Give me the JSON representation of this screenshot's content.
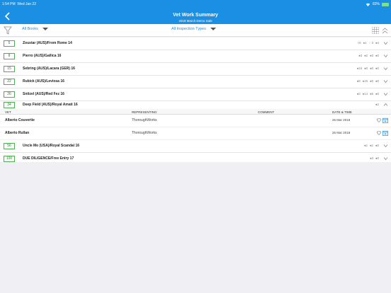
{
  "status_bar": {
    "time": "1:54 PM",
    "date": "Wed Jan 22",
    "battery_pct": "83%"
  },
  "header": {
    "title": "Vet Work Summary",
    "subtitle": "2018 March Demo Sale"
  },
  "filters": {
    "books": "All Books",
    "inspection_types": "All Inspection Types"
  },
  "vet_table": {
    "headers": {
      "vet": "VET",
      "representing": "REPRESENTING",
      "comment": "COMMENT",
      "datetime": "DATE & TIME"
    }
  },
  "lots": [
    {
      "lot": "5",
      "horse": "Zoustar (AUS)/From Rome 14",
      "counts": [
        "☇8",
        "♠1",
        "♢3",
        "♠4"
      ],
      "expanded": false
    },
    {
      "lot": "8",
      "horse": "Pierro (AUS)/Gallica 16",
      "counts": [
        "♠3",
        "♠2",
        "♠3",
        "♠0"
      ],
      "expanded": false
    },
    {
      "lot": "15",
      "horse": "Sebring (AUS)/Lacara (GER) 16",
      "counts": [
        "♠16",
        "♠0",
        "♠0",
        "♠0"
      ],
      "expanded": false
    },
    {
      "lot": "22",
      "horse": "Rubick (AUS)/Leviosa 16",
      "counts": [
        "♠9",
        "♠16",
        "♠0",
        "♠0"
      ],
      "expanded": false
    },
    {
      "lot": "26",
      "horse": "Snitzel (AUS)/Red Fez 16",
      "counts": [
        "♠3",
        "♠14",
        "♠5",
        "♠0"
      ],
      "expanded": false
    },
    {
      "lot": "34",
      "horse": "Deep Field (AUS)/Royal Amati 16",
      "counts": [
        "♠2"
      ],
      "expanded": true,
      "vets": [
        {
          "name": "Alberto Couvertie",
          "representing": "ThoroughWorks",
          "comment": "",
          "date": "26 Mar 2018"
        },
        {
          "name": "Alberto Rullan",
          "representing": "ThoroughWorks",
          "comment": "",
          "date": "26 Mar 2018"
        }
      ]
    },
    {
      "lot": "56",
      "horse": "Uncle Mo (USA)/Royal Scandal 16",
      "counts": [
        "♠1",
        "♠1",
        "♠0"
      ],
      "expanded": false
    },
    {
      "lot": "100",
      "horse": "DUE DILIGENCE/Free Entry 17",
      "counts": [
        "♠3",
        "♠0"
      ],
      "expanded": false
    }
  ],
  "colors": {
    "header_blue": "#1a8fe3",
    "lot_green": "#4caf50"
  }
}
